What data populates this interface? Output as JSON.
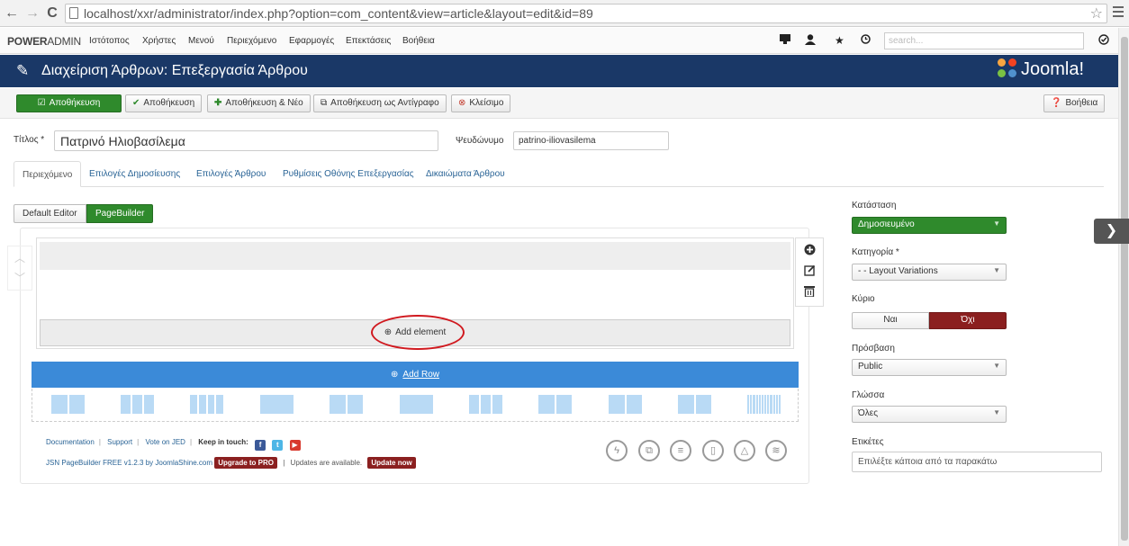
{
  "browser": {
    "back": "←",
    "forward": "→",
    "reload": "C",
    "url": "localhost/xxr/administrator/index.php?option=com_content&view=article&layout=edit&id=89"
  },
  "adminbar": {
    "brand_bold": "POWER",
    "brand_rest": "ADMIN",
    "menu": [
      "Ιστότοπος",
      "Χρήστες",
      "Μενού",
      "Περιεχόμενο",
      "Εφαρμογές",
      "Επεκτάσεις",
      "Βοήθεια"
    ],
    "search_placeholder": "search..."
  },
  "header": {
    "title": "Διαχείριση Άρθρων: Επεξεργασία Άρθρου",
    "logo_text": "Joomla!"
  },
  "toolbar": {
    "save": "Αποθήκευση",
    "save_close": "Αποθήκευση",
    "save_new": "Αποθήκευση & Νέο",
    "save_copy": "Αποθήκευση ως Αντίγραφο",
    "close": "Κλείσιμο",
    "help": "Βοήθεια"
  },
  "form": {
    "title_label": "Τίτλος *",
    "title_value": "Πατρινό Ηλιοβασίλεμα",
    "alias_label": "Ψευδώνυμο",
    "alias_value": "patrino-iliovasilema"
  },
  "tabs": [
    "Περιεχόμενο",
    "Επιλογές Δημοσίευσης",
    "Επιλογές Άρθρου",
    "Ρυθμίσεις Οθόνης Επεξεργασίας",
    "Δικαιώματα Άρθρου"
  ],
  "editor": {
    "default_label": "Default Editor",
    "pagebuilder_label": "PageBuilder",
    "add_element": "Add element",
    "add_row": "Add Row",
    "layout_columns": [
      2,
      3,
      4,
      1,
      2,
      1,
      3,
      2,
      2,
      2,
      12
    ]
  },
  "footer": {
    "documentation": "Documentation",
    "support": "Support",
    "vote": "Vote on JED",
    "keep_in_touch": "Keep in touch:",
    "version": "JSN PageBuilder FREE v1.2.3 by JoomlaShine.com",
    "upgrade": "Upgrade to PRO",
    "updates": "Updates are available.",
    "update_now": "Update now"
  },
  "sidebar": {
    "status_label": "Κατάσταση",
    "status_value": "Δημοσιευμένο",
    "category_label": "Κατηγορία *",
    "category_value": "- - Layout Variations",
    "featured_label": "Κύριο",
    "featured_yes": "Ναι",
    "featured_no": "Όχι",
    "access_label": "Πρόσβαση",
    "access_value": "Public",
    "language_label": "Γλώσσα",
    "language_value": "Όλες",
    "tags_label": "Ετικέτες",
    "tags_placeholder": "Επιλέξτε κάποια από τα παρακάτω"
  },
  "colors": {
    "header_bg": "#1a3867",
    "save_green": "#2f8a2c",
    "add_row_blue": "#3b8ad8",
    "featured_no_red": "#8b1f1f",
    "highlight_oval": "#d0191f"
  }
}
